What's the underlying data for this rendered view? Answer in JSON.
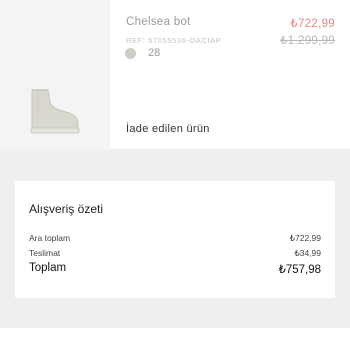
{
  "product": {
    "name": "Chelsea bot",
    "price": "₺722,99",
    "old_price": "₺1.299,99",
    "ref": "REF: 57055536-OACIAP",
    "size": "28",
    "return_status": "İade edilen ürün",
    "swatch_color": "#cfcdc4"
  },
  "summary": {
    "title": "Alışveriş özeti",
    "subtotal_label": "Ara toplam",
    "subtotal_value": "₺722,99",
    "shipping_label": "Teslimat",
    "shipping_value": "₺34,99",
    "total_label": "Toplam",
    "total_value": "₺757,98"
  }
}
